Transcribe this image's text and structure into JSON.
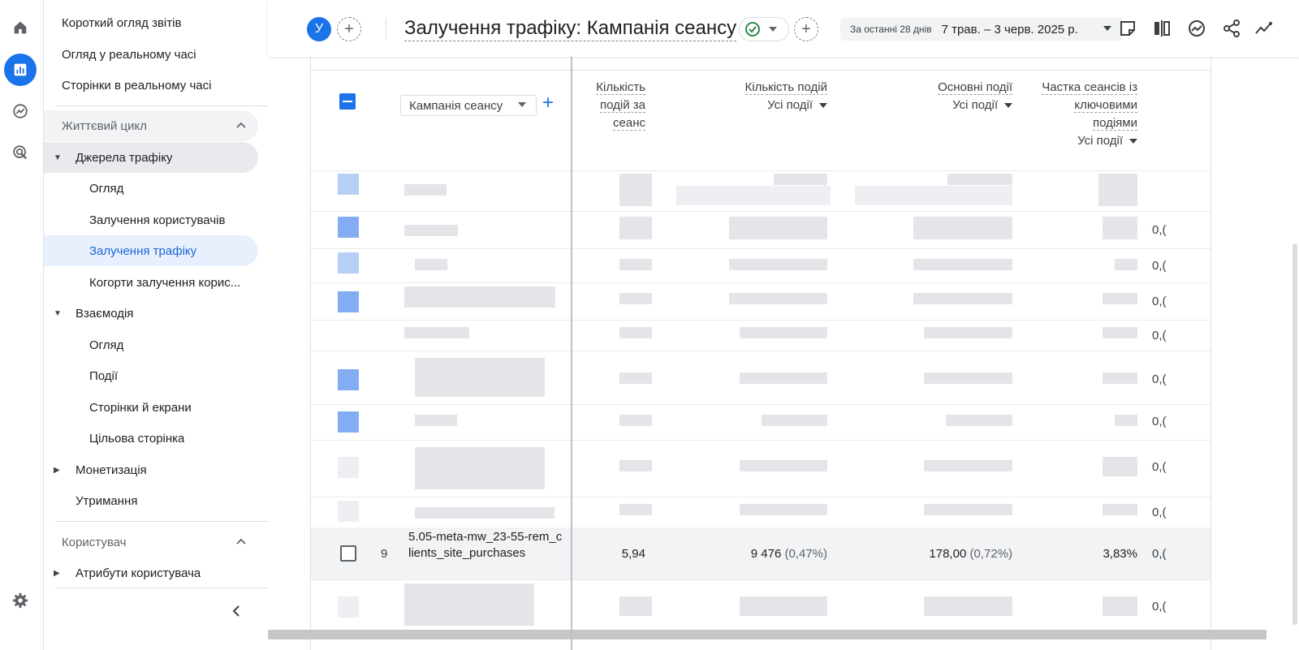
{
  "icons": {
    "rail": [
      "home-icon",
      "reports-icon",
      "explore-icon",
      "advertising-icon",
      "settings-icon"
    ],
    "header": [
      "insights-icon",
      "compare-icon",
      "trend-icon",
      "share-icon",
      "sparkline-icon"
    ]
  },
  "colors": {
    "accent": "#1a73e8",
    "selected_bg": "#e8f0fe",
    "selected_text": "#1967d2"
  },
  "sidebar": {
    "top_items": [
      {
        "label": "Короткий огляд звітів"
      },
      {
        "label": "Огляд у реальному часі"
      },
      {
        "label": "Сторінки в реальному часі"
      }
    ],
    "section_lifecycle": "Життєвий цикл",
    "acquisition": {
      "label": "Джерела трафіку",
      "items": [
        "Огляд",
        "Залучення користувачів",
        "Залучення трафіку",
        "Когорти залучення корис..."
      ]
    },
    "engagement": {
      "label": "Взаємодія",
      "items": [
        "Огляд",
        "Події",
        "Сторінки й екрани",
        "Цільова сторінка"
      ]
    },
    "monetization": "Монетизація",
    "retention": "Утримання",
    "section_user": "Користувач",
    "user_attributes": "Атрибути користувача"
  },
  "header": {
    "avatar_letter": "У",
    "title": "Залучення трафіку: Кампанія сеансу",
    "date_label": "За останні 28 днів",
    "date_range": "7 трав. – 3 черв. 2025 р."
  },
  "table": {
    "dimension": "Кампанія сеансу",
    "columns": [
      {
        "title": "Кількість подій за сеанс",
        "sub": ""
      },
      {
        "title": "Кількість подій",
        "sub": "Усі події"
      },
      {
        "title": "Основні події",
        "sub": "Усі події"
      },
      {
        "title": "Частка сеансів із ключовими подіями",
        "sub": "Усі події"
      }
    ],
    "tail_values": [
      "0,(",
      "0,(",
      "0,(",
      "0,(",
      "0,(",
      "0,(",
      "0,(",
      "0,(",
      "0,(",
      "0,("
    ],
    "highlight_row": {
      "index": "9",
      "campaign": "5.05-meta-mw_23-55-rem_clients_site_purchases",
      "events_per_session": "5,94",
      "event_count": "9 476",
      "event_count_pct": "(0,47%)",
      "key_events": "178,00",
      "key_events_pct": "(0,72%)",
      "session_key_rate": "3,83%",
      "tail": "0,("
    }
  }
}
